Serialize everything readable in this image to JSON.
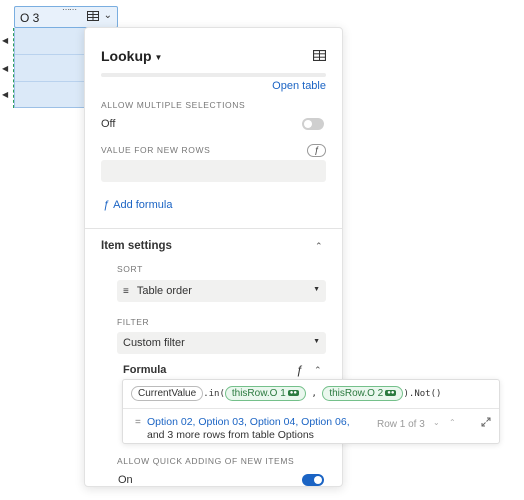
{
  "column": {
    "header": "O 3"
  },
  "panel": {
    "title": "Lookup",
    "open_table": "Open table",
    "allow_multiple": {
      "label": "ALLOW MULTIPLE SELECTIONS",
      "value": "Off"
    },
    "new_rows": {
      "label": "VALUE FOR NEW ROWS",
      "placeholder": ""
    },
    "add_formula": "Add formula",
    "item_settings": {
      "title": "Item settings",
      "sort": {
        "label": "SORT",
        "value": "Table order"
      },
      "filter": {
        "label": "FILTER",
        "value": "Custom filter"
      },
      "formula_label": "Formula"
    },
    "quick_add": {
      "label": "ALLOW QUICK ADDING OF NEW ITEMS",
      "value": "On"
    }
  },
  "formula": {
    "current_value": "CurrentValue",
    "in_call": ".in(",
    "arg1": "thisRow.O 1",
    "comma": ",",
    "arg2": "thisRow.O 2",
    "not_call": ").Not()",
    "result_links": [
      "Option 02",
      "Option 03",
      "Option 04",
      "Option 06"
    ],
    "result_more": "and 3 more rows from table Options",
    "row_indicator": "Row 1 of 3"
  },
  "colors": {
    "accent": "#1b64c4",
    "selection": "#dbe9f8",
    "green": "#2e9e5b"
  }
}
